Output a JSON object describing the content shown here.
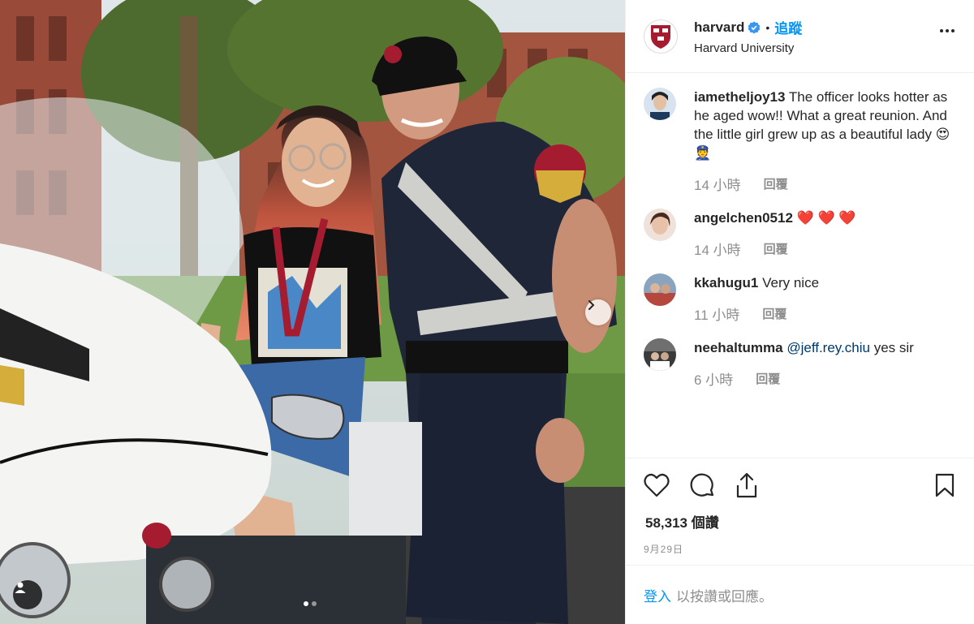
{
  "account": {
    "username": "harvard",
    "bullet": "•",
    "follow_label": "追蹤",
    "subtitle": "Harvard University"
  },
  "comments": [
    {
      "user": "iametheljoy13",
      "text": "The officer looks hotter as he aged wow!! What a great reunion. And the little girl grew up as a beautiful lady 😍 👮",
      "time": "14 小時",
      "reply": "回覆"
    },
    {
      "user": "angelchen0512",
      "text": "❤️ ❤️ ❤️",
      "time": "14 小時",
      "reply": "回覆"
    },
    {
      "user": "kkahugu1",
      "text": "Very nice",
      "time": "11 小時",
      "reply": "回覆"
    },
    {
      "user": "neehaltumma",
      "mention": "@jeff.rey.chiu",
      "text": "yes sir",
      "time": "6 小時",
      "reply": "回覆"
    }
  ],
  "stats": {
    "likes": "58,313 個讚",
    "date": "9月29日"
  },
  "login": {
    "link": "登入",
    "text": "以按讚或回應。"
  },
  "carousel": {
    "current": 1,
    "total": 2
  },
  "colors": {
    "accent": "#0095f6",
    "mention": "#00376b",
    "muted": "#8e8e8e",
    "crimson": "#a51c30"
  },
  "icons": {
    "header": [
      "harvard-shield-icon",
      "verified-badge-icon",
      "more-options-icon"
    ],
    "actions": [
      "heart-icon",
      "comment-icon",
      "share-icon",
      "bookmark-icon"
    ],
    "photo": [
      "chevron-right-icon",
      "user-tag-icon"
    ]
  }
}
